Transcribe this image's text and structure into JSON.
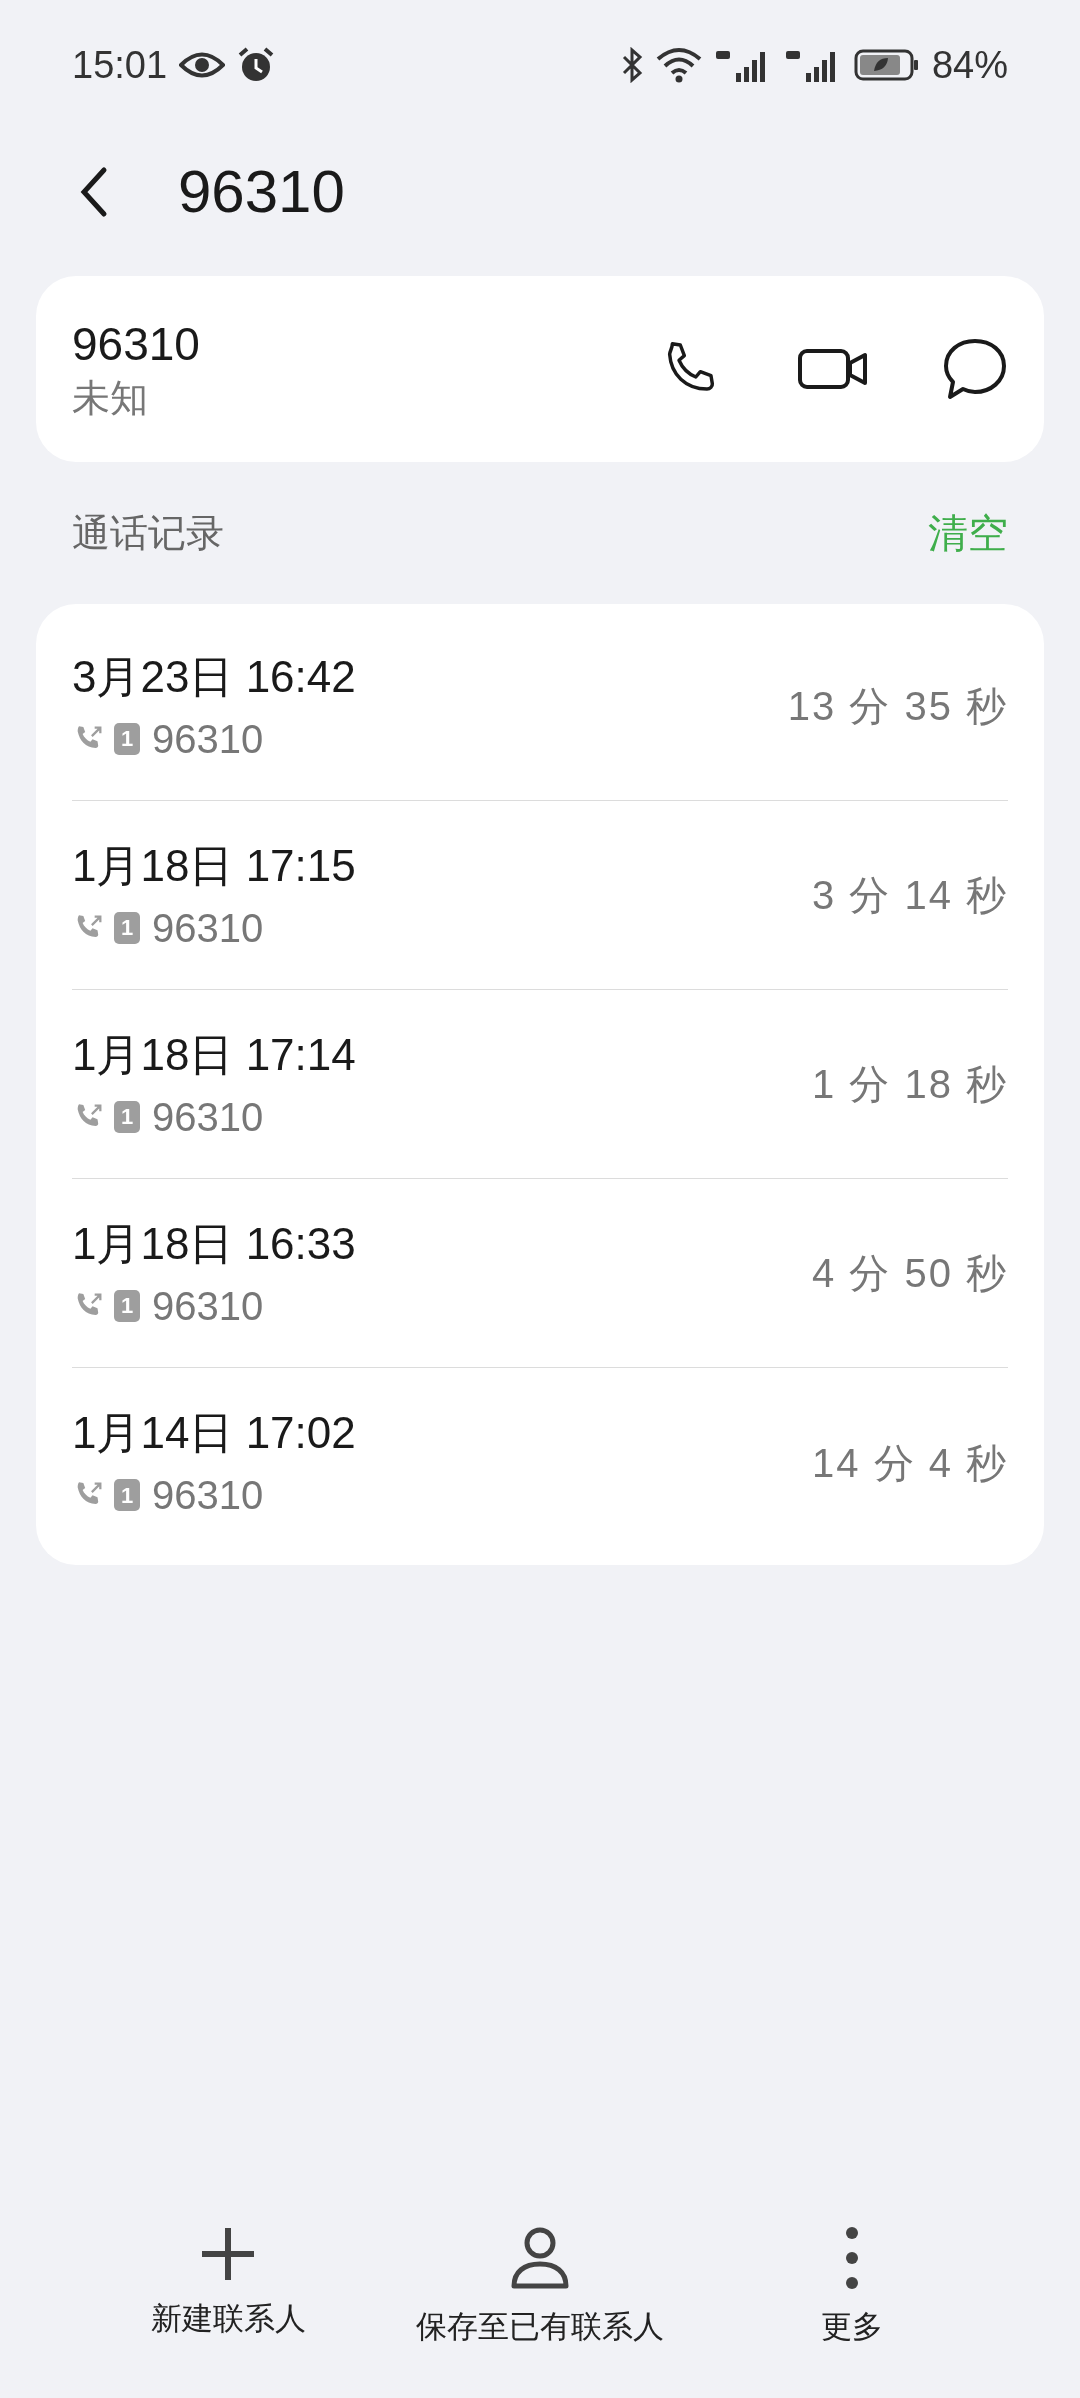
{
  "status_bar": {
    "time": "15:01",
    "battery": "84%"
  },
  "header": {
    "title": "96310"
  },
  "contact": {
    "number": "96310",
    "label": "未知"
  },
  "section": {
    "title": "通话记录",
    "action": "清空"
  },
  "calls": [
    {
      "datetime": "3月23日 16:42",
      "sim": "1",
      "number": "96310",
      "duration": "13 分 35 秒"
    },
    {
      "datetime": "1月18日 17:15",
      "sim": "1",
      "number": "96310",
      "duration": "3 分 14 秒"
    },
    {
      "datetime": "1月18日 17:14",
      "sim": "1",
      "number": "96310",
      "duration": "1 分 18 秒"
    },
    {
      "datetime": "1月18日 16:33",
      "sim": "1",
      "number": "96310",
      "duration": "4 分 50 秒"
    },
    {
      "datetime": "1月14日 17:02",
      "sim": "1",
      "number": "96310",
      "duration": "14 分 4 秒"
    }
  ],
  "bottom_bar": [
    {
      "kind": "add",
      "label": "新建联系人"
    },
    {
      "kind": "person",
      "label": "保存至已有联系人"
    },
    {
      "kind": "more",
      "label": "更多"
    }
  ]
}
